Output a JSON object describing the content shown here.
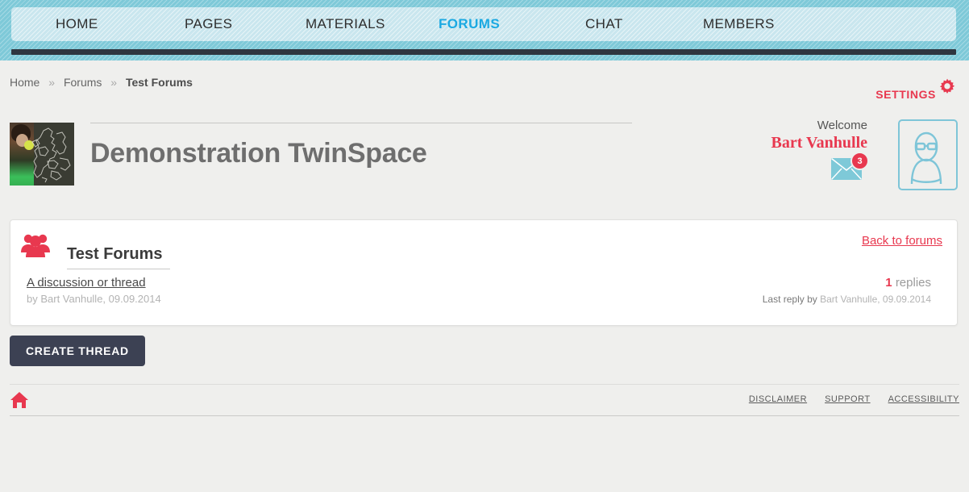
{
  "nav": {
    "items": [
      {
        "id": "home",
        "label": "HOME",
        "active": false
      },
      {
        "id": "pages",
        "label": "PAGES",
        "active": false
      },
      {
        "id": "materials",
        "label": "MATERIALS",
        "active": false
      },
      {
        "id": "forums",
        "label": "FORUMS",
        "active": true
      },
      {
        "id": "chat",
        "label": "CHAT",
        "active": false
      },
      {
        "id": "members",
        "label": "MEMBERS",
        "active": false
      }
    ]
  },
  "breadcrumb": {
    "home": "Home",
    "sep1": "»",
    "forums": "Forums",
    "sep2": "»",
    "current": "Test Forums"
  },
  "settings": {
    "label": "SETTINGS",
    "icon": "gear-icon"
  },
  "header": {
    "space_title": "Demonstration TwinSpace",
    "thumbnail_alt": "twinspace-thumbnail"
  },
  "user": {
    "welcome_label": "Welcome",
    "name": "Bart Vanhulle",
    "messages_badge": "3",
    "mail_icon": "envelope-icon",
    "avatar_icon": "user-avatar-icon"
  },
  "forum": {
    "icon": "group-people-icon",
    "title": "Test Forums",
    "back_link": "Back to forums",
    "threads": [
      {
        "title": "A discussion or thread",
        "meta": "by Bart Vanhulle, 09.09.2014",
        "replies_count": "1",
        "replies_label": "replies",
        "last_reply_prefix": "Last reply by",
        "last_reply_by": "Bart Vanhulle, 09.09.2014"
      }
    ]
  },
  "actions": {
    "create_thread": "CREATE THREAD"
  },
  "footer": {
    "home_icon": "home-icon",
    "links": [
      {
        "label": "DISCLAIMER"
      },
      {
        "label": "SUPPORT"
      },
      {
        "label": "ACCESSIBILITY"
      }
    ]
  },
  "colors": {
    "band_teal": "#7ec9d8",
    "nav_panel": "#c9e6ee",
    "nav_active": "#1ba9e2",
    "accent_red": "#e8384f",
    "dark_bar": "#2f3640",
    "button_navy": "#3c4153",
    "page_bg": "#efefed"
  }
}
